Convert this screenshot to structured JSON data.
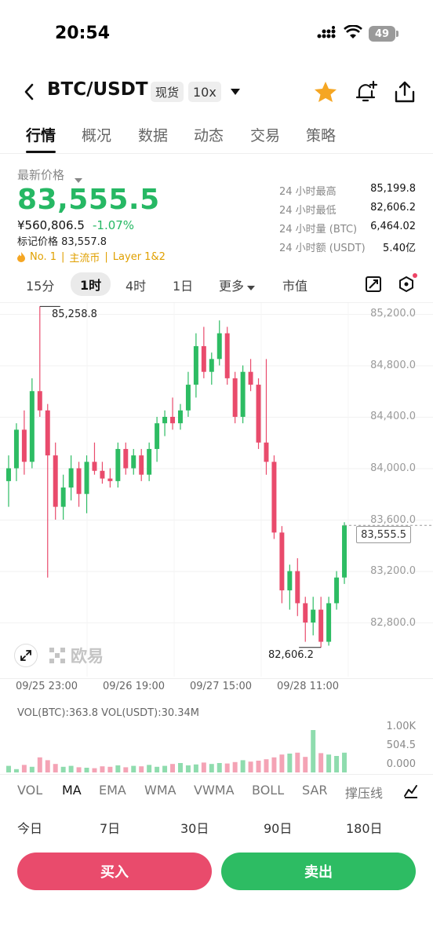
{
  "status_bar": {
    "time": "20:54",
    "battery": "49"
  },
  "header": {
    "pair": "BTC/USDT",
    "market_tag": "现货",
    "leverage_tag": "10x"
  },
  "tabs": [
    "行情",
    "概况",
    "数据",
    "动态",
    "交易",
    "策略"
  ],
  "price_panel": {
    "label": "最新价格",
    "last_price": "83,555.5",
    "cny_price": "¥560,806.5",
    "change_pct": "-1.07%",
    "mark_price": "标记价格 83,557.8",
    "rank": "No. 1",
    "tag1": "主流币",
    "tag2": "Layer 1&2",
    "stats": [
      {
        "label": "24 小时最高",
        "value": "85,199.8"
      },
      {
        "label": "24 小时最低",
        "value": "82,606.2"
      },
      {
        "label": "24 小时量 (BTC)",
        "value": "6,464.02"
      },
      {
        "label": "24 小时额 (USDT)",
        "value": "5.40亿"
      }
    ]
  },
  "intervals": [
    "15分",
    "1时",
    "4时",
    "1日",
    "更多",
    "市值"
  ],
  "chart": {
    "y_labels": [
      "85,200.0",
      "84,800.0",
      "84,400.0",
      "84,000.0",
      "83,600.0",
      "83,200.0",
      "82,800.0"
    ],
    "current_price": "83,555.5",
    "high_label": "85,258.8",
    "low_label": "82,606.2",
    "watermark": "欧易",
    "time_labels": [
      "09/25 23:00",
      "09/26 19:00",
      "09/27 15:00",
      "09/28 11:00"
    ],
    "colors": {
      "up": "#2dbc63",
      "down": "#e94b6c"
    }
  },
  "volume": {
    "header": "VOL(BTC):363.8 VOL(USDT):30.34M",
    "y_labels": [
      "1.00K",
      "504.5",
      "0.000"
    ]
  },
  "indicators": [
    "VOL",
    "MA",
    "EMA",
    "WMA",
    "VWMA",
    "BOLL",
    "SAR",
    "撑压线"
  ],
  "ranges": [
    "今日",
    "7日",
    "30日",
    "90日",
    "180日"
  ],
  "actions": {
    "buy": "买入",
    "sell": "卖出"
  },
  "chart_data": {
    "type": "candlestick",
    "series": [
      {
        "o": 83900,
        "h": 84100,
        "l": 83700,
        "c": 84000
      },
      {
        "o": 84000,
        "h": 84350,
        "l": 83900,
        "c": 84300
      },
      {
        "o": 84300,
        "h": 84450,
        "l": 83950,
        "c": 84050
      },
      {
        "o": 84050,
        "h": 84700,
        "l": 84000,
        "c": 84600
      },
      {
        "o": 84600,
        "h": 85258.8,
        "l": 84400,
        "c": 84450
      },
      {
        "o": 84450,
        "h": 84500,
        "l": 83150,
        "c": 84100
      },
      {
        "o": 84100,
        "h": 84200,
        "l": 83600,
        "c": 83700
      },
      {
        "o": 83700,
        "h": 83950,
        "l": 83600,
        "c": 83850
      },
      {
        "o": 83850,
        "h": 84100,
        "l": 83750,
        "c": 84000
      },
      {
        "o": 84000,
        "h": 84050,
        "l": 83700,
        "c": 83800
      },
      {
        "o": 83800,
        "h": 84100,
        "l": 83650,
        "c": 84050
      },
      {
        "o": 84050,
        "h": 84200,
        "l": 83950,
        "c": 83980
      },
      {
        "o": 83980,
        "h": 84050,
        "l": 83880,
        "c": 83920
      },
      {
        "o": 83920,
        "h": 84000,
        "l": 83850,
        "c": 83900
      },
      {
        "o": 83900,
        "h": 84200,
        "l": 83850,
        "c": 84150
      },
      {
        "o": 84150,
        "h": 84200,
        "l": 83950,
        "c": 84000
      },
      {
        "o": 84000,
        "h": 84150,
        "l": 83950,
        "c": 84100
      },
      {
        "o": 84100,
        "h": 84150,
        "l": 83900,
        "c": 83950
      },
      {
        "o": 83950,
        "h": 84200,
        "l": 83900,
        "c": 84150
      },
      {
        "o": 84150,
        "h": 84400,
        "l": 84050,
        "c": 84350
      },
      {
        "o": 84350,
        "h": 84450,
        "l": 84250,
        "c": 84400
      },
      {
        "o": 84400,
        "h": 84550,
        "l": 84300,
        "c": 84350
      },
      {
        "o": 84350,
        "h": 84500,
        "l": 84300,
        "c": 84450
      },
      {
        "o": 84450,
        "h": 84750,
        "l": 84400,
        "c": 84650
      },
      {
        "o": 84650,
        "h": 85050,
        "l": 84550,
        "c": 84950
      },
      {
        "o": 84950,
        "h": 85100,
        "l": 84700,
        "c": 84750
      },
      {
        "o": 84750,
        "h": 84900,
        "l": 84650,
        "c": 84850
      },
      {
        "o": 84850,
        "h": 85150,
        "l": 84800,
        "c": 85050
      },
      {
        "o": 85050,
        "h": 85100,
        "l": 84650,
        "c": 84700
      },
      {
        "o": 84700,
        "h": 84750,
        "l": 84350,
        "c": 84400
      },
      {
        "o": 84400,
        "h": 84800,
        "l": 84350,
        "c": 84750
      },
      {
        "o": 84750,
        "h": 84850,
        "l": 84600,
        "c": 84650
      },
      {
        "o": 84650,
        "h": 84700,
        "l": 84150,
        "c": 84200
      },
      {
        "o": 84200,
        "h": 84850,
        "l": 83950,
        "c": 84050
      },
      {
        "o": 84050,
        "h": 84100,
        "l": 83450,
        "c": 83500
      },
      {
        "o": 83500,
        "h": 83550,
        "l": 82950,
        "c": 83050
      },
      {
        "o": 83050,
        "h": 83250,
        "l": 82900,
        "c": 83200
      },
      {
        "o": 83200,
        "h": 83300,
        "l": 82850,
        "c": 82950
      },
      {
        "o": 82950,
        "h": 83000,
        "l": 82650,
        "c": 82800
      },
      {
        "o": 82800,
        "h": 83000,
        "l": 82700,
        "c": 82900
      },
      {
        "o": 82900,
        "h": 83000,
        "l": 82606.2,
        "c": 82650
      },
      {
        "o": 82650,
        "h": 83000,
        "l": 82620,
        "c": 82950
      },
      {
        "o": 82950,
        "h": 83200,
        "l": 82900,
        "c": 83150
      },
      {
        "o": 83150,
        "h": 83580,
        "l": 83100,
        "c": 83555.5
      }
    ],
    "volume": [
      140,
      70,
      160,
      120,
      320,
      260,
      180,
      120,
      140,
      110,
      100,
      90,
      130,
      120,
      150,
      110,
      140,
      130,
      160,
      120,
      140,
      180,
      200,
      150,
      170,
      210,
      180,
      200,
      190,
      220,
      260,
      230,
      250,
      280,
      320,
      380,
      400,
      420,
      330,
      900,
      410,
      380,
      350,
      420
    ],
    "ylim": [
      82550,
      85350
    ]
  }
}
